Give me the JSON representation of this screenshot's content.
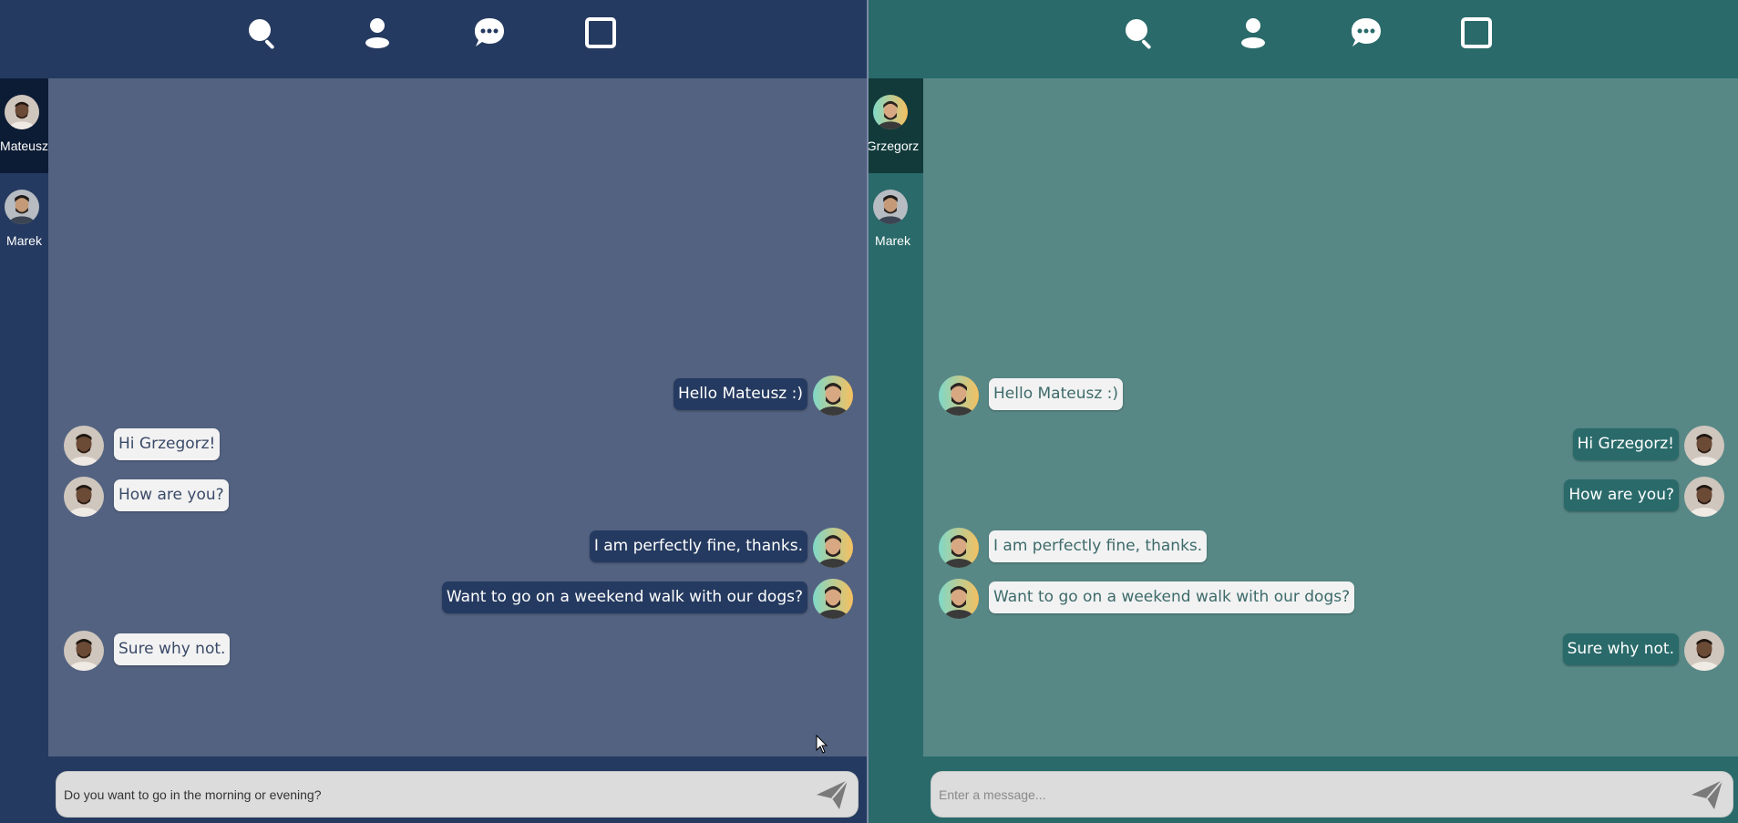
{
  "theme": {
    "left": {
      "bar": "#253a60",
      "sidebar": "#253a60",
      "chat_bg": "#536281",
      "active_contact": "#0d1c35",
      "bubble_own": "#253a60",
      "bubble_own_text": "#ffffff",
      "bubble_other": "#f2f2f2",
      "bubble_other_text": "#3a4a68"
    },
    "right": {
      "bar": "#2a6a6a",
      "sidebar": "#2a6a6a",
      "chat_bg": "#578886",
      "active_contact": "#123a3a",
      "bubble_own": "#2a6a6a",
      "bubble_own_text": "#ffffff",
      "bubble_other": "#f2f2f2",
      "bubble_other_text": "#3d6a6a"
    }
  },
  "nav": {
    "icons": [
      "search-icon",
      "user-icon",
      "chat-icon",
      "window-icon"
    ]
  },
  "left_pane": {
    "contacts": [
      {
        "name": "Mateusz",
        "active": true
      },
      {
        "name": "Marek",
        "active": false
      }
    ],
    "messages": [
      {
        "text": "Hello Mateusz :)",
        "mine": true
      },
      {
        "text": "Hi Grzegorz!",
        "mine": false
      },
      {
        "text": "How are you?",
        "mine": false
      },
      {
        "text": "I am perfectly fine, thanks.",
        "mine": true
      },
      {
        "text": "Want to go on a weekend walk with our dogs?",
        "mine": true
      },
      {
        "text": "Sure why not.",
        "mine": false
      }
    ],
    "composer": {
      "value": "Do you want to go in the morning or evening?",
      "placeholder": "Enter a message..."
    }
  },
  "right_pane": {
    "contacts": [
      {
        "name": "Grzegorz",
        "active": true
      },
      {
        "name": "Marek",
        "active": false
      }
    ],
    "messages": [
      {
        "text": "Hello Mateusz :)",
        "mine": false
      },
      {
        "text": "Hi Grzegorz!",
        "mine": true
      },
      {
        "text": "How are you?",
        "mine": true
      },
      {
        "text": "I am perfectly fine, thanks.",
        "mine": false
      },
      {
        "text": "Want to go on a weekend walk with our dogs?",
        "mine": false
      },
      {
        "text": "Sure why not.",
        "mine": true
      }
    ],
    "composer": {
      "value": "",
      "placeholder": "Enter a message..."
    }
  }
}
